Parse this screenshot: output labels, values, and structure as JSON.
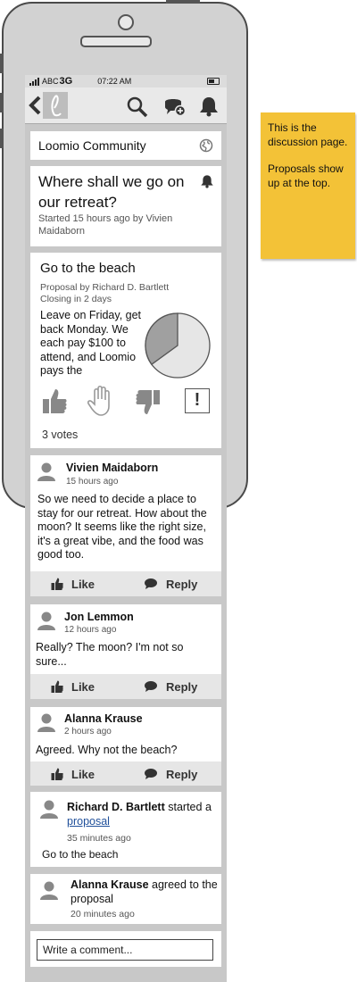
{
  "status_bar": {
    "carrier": "ABC",
    "network": "3G",
    "time": "07:22 AM"
  },
  "header": {
    "group_name": "Loomio Community"
  },
  "discussion": {
    "title": "Where shall we go on our retreat?",
    "started": "Started 15 hours ago by Vivien Maidaborn"
  },
  "proposal": {
    "title": "Go to the beach",
    "by": "Proposal by Richard D. Bartlett",
    "closing": "Closing in 2 days",
    "description": "Leave on Friday, get back Monday. We each pay $100 to attend, and Loomio pays the",
    "votes": "3 votes",
    "pie": {
      "agree_fraction": 0.35,
      "colors": {
        "agree": "#a0a0a0",
        "rest": "#e6e6e6"
      }
    }
  },
  "comments": [
    {
      "author": "Vivien Maidaborn",
      "time": "15 hours ago",
      "text": "So we need to decide a place to stay for our retreat. How about the moon? It seems like the right size, it's a great vibe, and the food was good too.",
      "like": "Like",
      "reply": "Reply"
    },
    {
      "author": "Jon Lemmon",
      "time": "12 hours ago",
      "text": "Really? The moon? I'm not so sure...",
      "like": "Like",
      "reply": "Reply"
    },
    {
      "author": "Alanna Krause",
      "time": "2 hours ago",
      "text": "Agreed. Why not the beach?",
      "like": "Like",
      "reply": "Reply"
    }
  ],
  "activity": [
    {
      "author": "Richard D. Bartlett",
      "verb": "started",
      "article": "a",
      "link": "proposal",
      "time": "35 minutes ago",
      "detail": "Go to the beach"
    },
    {
      "author": "Alanna Krause",
      "verb": "agreed to",
      "object": "the proposal",
      "time": "20 minutes ago"
    }
  ],
  "comment_box": {
    "placeholder": "Write a comment..."
  },
  "sticky_note": {
    "line1": "This is the discussion page.",
    "line2": "Proposals show up at the top."
  },
  "icons": [
    "back-arrow-icon",
    "loomio-logo-icon",
    "search-icon",
    "new-discussion-icon",
    "bell-icon",
    "globe-icon",
    "thumbs-up-icon",
    "hand-abstain-icon",
    "thumbs-down-icon",
    "block-icon",
    "person-icon",
    "like-icon",
    "reply-icon"
  ]
}
